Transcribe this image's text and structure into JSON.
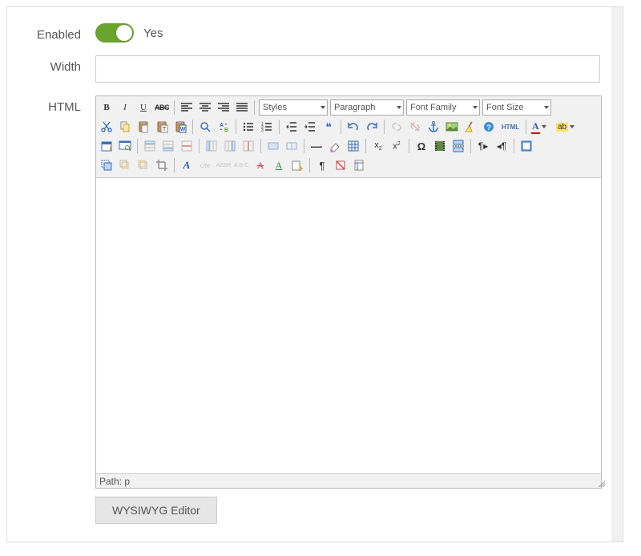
{
  "labels": {
    "enabled": "Enabled",
    "width": "Width",
    "html": "HTML"
  },
  "enabled": {
    "value_label": "Yes",
    "on": true
  },
  "width": {
    "value": "",
    "placeholder": ""
  },
  "editor": {
    "selects": {
      "styles": "Styles",
      "format": "Paragraph",
      "fontfamily": "Font Family",
      "fontsize": "Font Size"
    },
    "path_label": "Path:",
    "path_value": "p",
    "content": ""
  },
  "buttons": {
    "wysiwyg": "WYSIWYG Editor"
  },
  "icons": {
    "bold": "B",
    "italic": "I",
    "underline": "U",
    "strike": "ABC",
    "html_badge": "HTML",
    "forecolor_letter": "A",
    "backcolor_letter": "ab",
    "sub": "x",
    "sup": "x",
    "omega": "Ω",
    "hr": "—",
    "quote": "❝",
    "pilcrow": "¶",
    "styletext": "A",
    "ltr": "¶",
    "rtl": "¶"
  }
}
